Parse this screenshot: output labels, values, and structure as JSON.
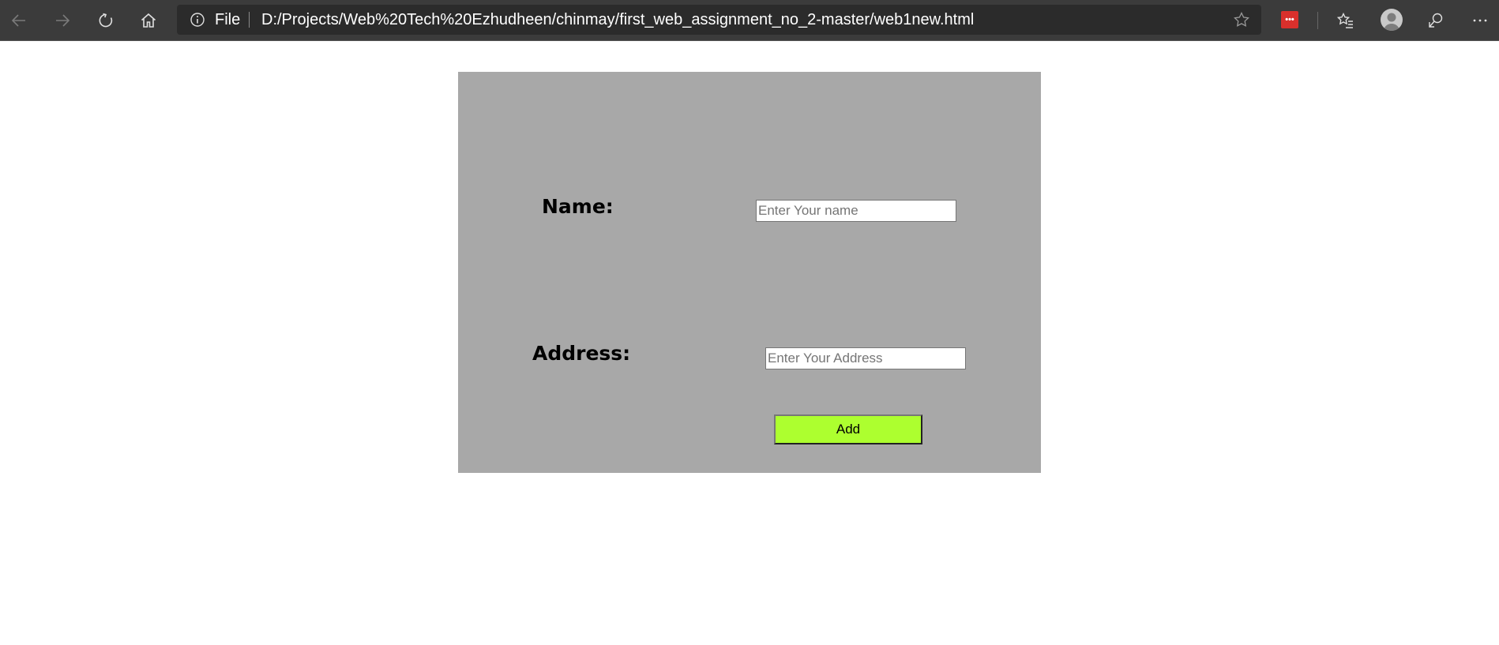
{
  "browser": {
    "file_label": "File",
    "url": "D:/Projects/Web%20Tech%20Ezhudheen/chinmay/first_web_assignment_no_2-master/web1new.html",
    "icons": [
      "back-icon",
      "forward-icon",
      "refresh-icon",
      "home-icon",
      "info-icon",
      "favorite-star-icon",
      "extension-icon",
      "favorites-icon",
      "profile-avatar",
      "feedback-icon",
      "more-icon"
    ],
    "extension_badge": "•••"
  },
  "form": {
    "name_label": "Name:",
    "name_placeholder": "Enter Your name",
    "name_value": "",
    "address_label": "Address:",
    "address_placeholder": "Enter Your Address",
    "address_value": "",
    "submit_label": "Add",
    "panel_color": "#a8a8a8",
    "button_color": "#adff2f"
  }
}
